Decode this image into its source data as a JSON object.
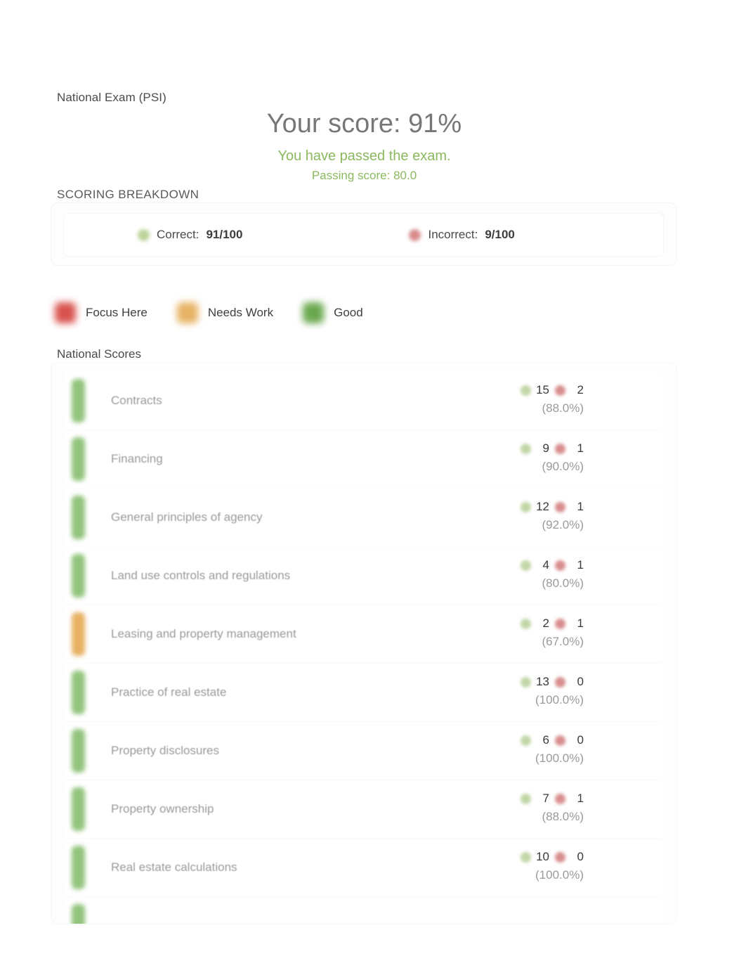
{
  "header": {
    "exam_name": "National Exam (PSI)",
    "score_headline": "Your score: 91%",
    "pass_message": "You have passed the exam.",
    "passing_score": "Passing score: 80.0"
  },
  "breakdown": {
    "title": "SCORING BREAKDOWN",
    "correct_label": "Correct:",
    "correct_value": "91/100",
    "incorrect_label": "Incorrect:",
    "incorrect_value": "9/100",
    "correct_icon": "check-circle-icon",
    "incorrect_icon": "x-circle-icon"
  },
  "legend": {
    "items": [
      {
        "label": "Focus Here",
        "color": "#d9534f",
        "key": "focus"
      },
      {
        "label": "Needs Work",
        "color": "#e8b264",
        "key": "needs"
      },
      {
        "label": "Good",
        "color": "#93c47d",
        "key": "good"
      }
    ]
  },
  "scores": {
    "title": "National Scores",
    "rows": [
      {
        "label": "Contracts",
        "correct": "15",
        "incorrect": "2",
        "percent": "(88.0%)",
        "status": "good"
      },
      {
        "label": "Financing",
        "correct": "9",
        "incorrect": "1",
        "percent": "(90.0%)",
        "status": "good"
      },
      {
        "label": "General principles of agency",
        "correct": "12",
        "incorrect": "1",
        "percent": "(92.0%)",
        "status": "good"
      },
      {
        "label": "Land use controls and regulations",
        "correct": "4",
        "incorrect": "1",
        "percent": "(80.0%)",
        "status": "good"
      },
      {
        "label": "Leasing and property management",
        "correct": "2",
        "incorrect": "1",
        "percent": "(67.0%)",
        "status": "needs"
      },
      {
        "label": "Practice of real estate",
        "correct": "13",
        "incorrect": "0",
        "percent": "(100.0%)",
        "status": "good"
      },
      {
        "label": "Property disclosures",
        "correct": "6",
        "incorrect": "0",
        "percent": "(100.0%)",
        "status": "good"
      },
      {
        "label": "Property ownership",
        "correct": "7",
        "incorrect": "1",
        "percent": "(88.0%)",
        "status": "good"
      },
      {
        "label": "Real estate calculations",
        "correct": "10",
        "incorrect": "0",
        "percent": "(100.0%)",
        "status": "good"
      }
    ],
    "partial_row": {
      "status": "good"
    }
  }
}
